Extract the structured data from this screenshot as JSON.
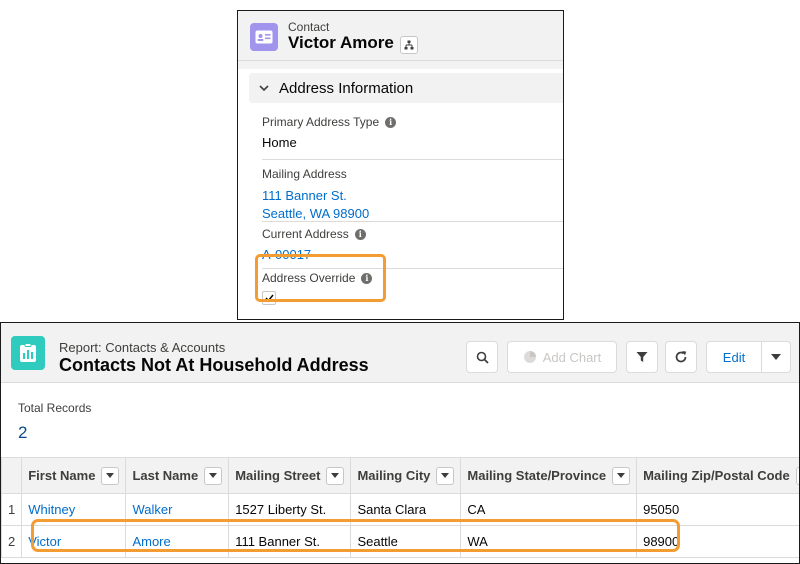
{
  "contact": {
    "object_type": "Contact",
    "name": "Victor Amore",
    "section_title": "Address Information",
    "fields": {
      "primary_address_type_label": "Primary Address Type",
      "primary_address_type_value": "Home",
      "mailing_address_label": "Mailing Address",
      "mailing_address_line1": "111 Banner St.",
      "mailing_address_line2": "Seattle, WA 98900",
      "current_address_label": "Current Address",
      "current_address_value": "A-00017",
      "address_override_label": "Address Override",
      "address_override_checked": true
    },
    "colors": {
      "icon_bg": "#a094ed",
      "highlight": "#f39c31"
    }
  },
  "report": {
    "type_label": "Report: Contacts & Accounts",
    "title": "Contacts Not At Household Address",
    "buttons": {
      "add_chart": "Add Chart",
      "edit": "Edit"
    },
    "summary": {
      "label": "Total Records",
      "value": "2"
    },
    "columns": [
      "First Name",
      "Last Name",
      "Mailing Street",
      "Mailing City",
      "Mailing State/Province",
      "Mailing Zip/Postal Code"
    ],
    "rows": [
      {
        "num": "1",
        "first": "Whitney",
        "last": "Walker",
        "street": "1527 Liberty St.",
        "city": "Santa Clara",
        "state": "CA",
        "zip": "95050"
      },
      {
        "num": "2",
        "first": "Victor",
        "last": "Amore",
        "street": "111 Banner St.",
        "city": "Seattle",
        "state": "WA",
        "zip": "98900"
      }
    ],
    "colors": {
      "icon_bg": "#2ecbbe",
      "link": "#006dcc"
    }
  }
}
